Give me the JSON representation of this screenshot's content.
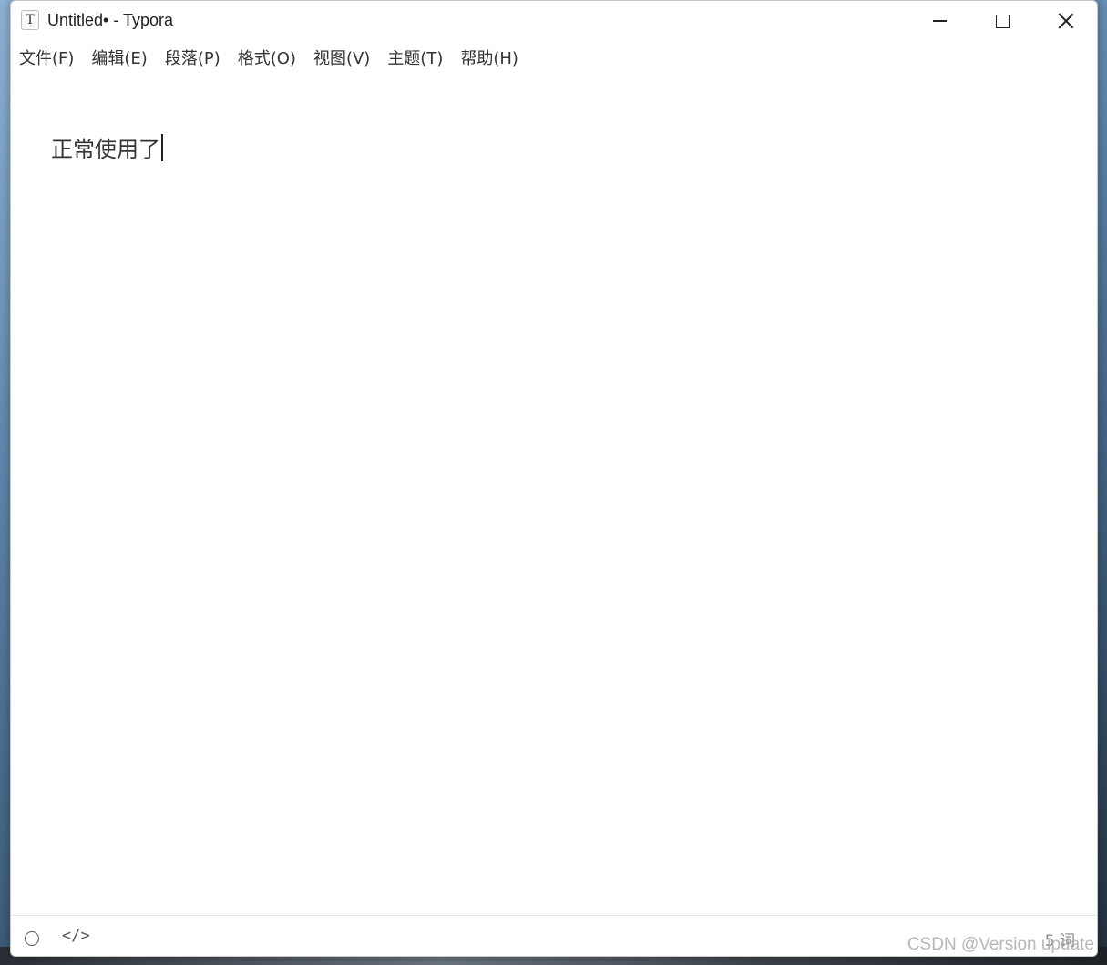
{
  "window": {
    "title": "Untitled• - Typora",
    "icon_letter": "T"
  },
  "menu": [
    {
      "label": "文件(F)"
    },
    {
      "label": "编辑(E)"
    },
    {
      "label": "段落(P)"
    },
    {
      "label": "格式(O)"
    },
    {
      "label": "视图(V)"
    },
    {
      "label": "主题(T)"
    },
    {
      "label": "帮助(H)"
    }
  ],
  "editor": {
    "content": "正常使用了"
  },
  "statusbar": {
    "source_symbol": "</>",
    "word_count": "5 词"
  },
  "watermark": "CSDN @Version update"
}
